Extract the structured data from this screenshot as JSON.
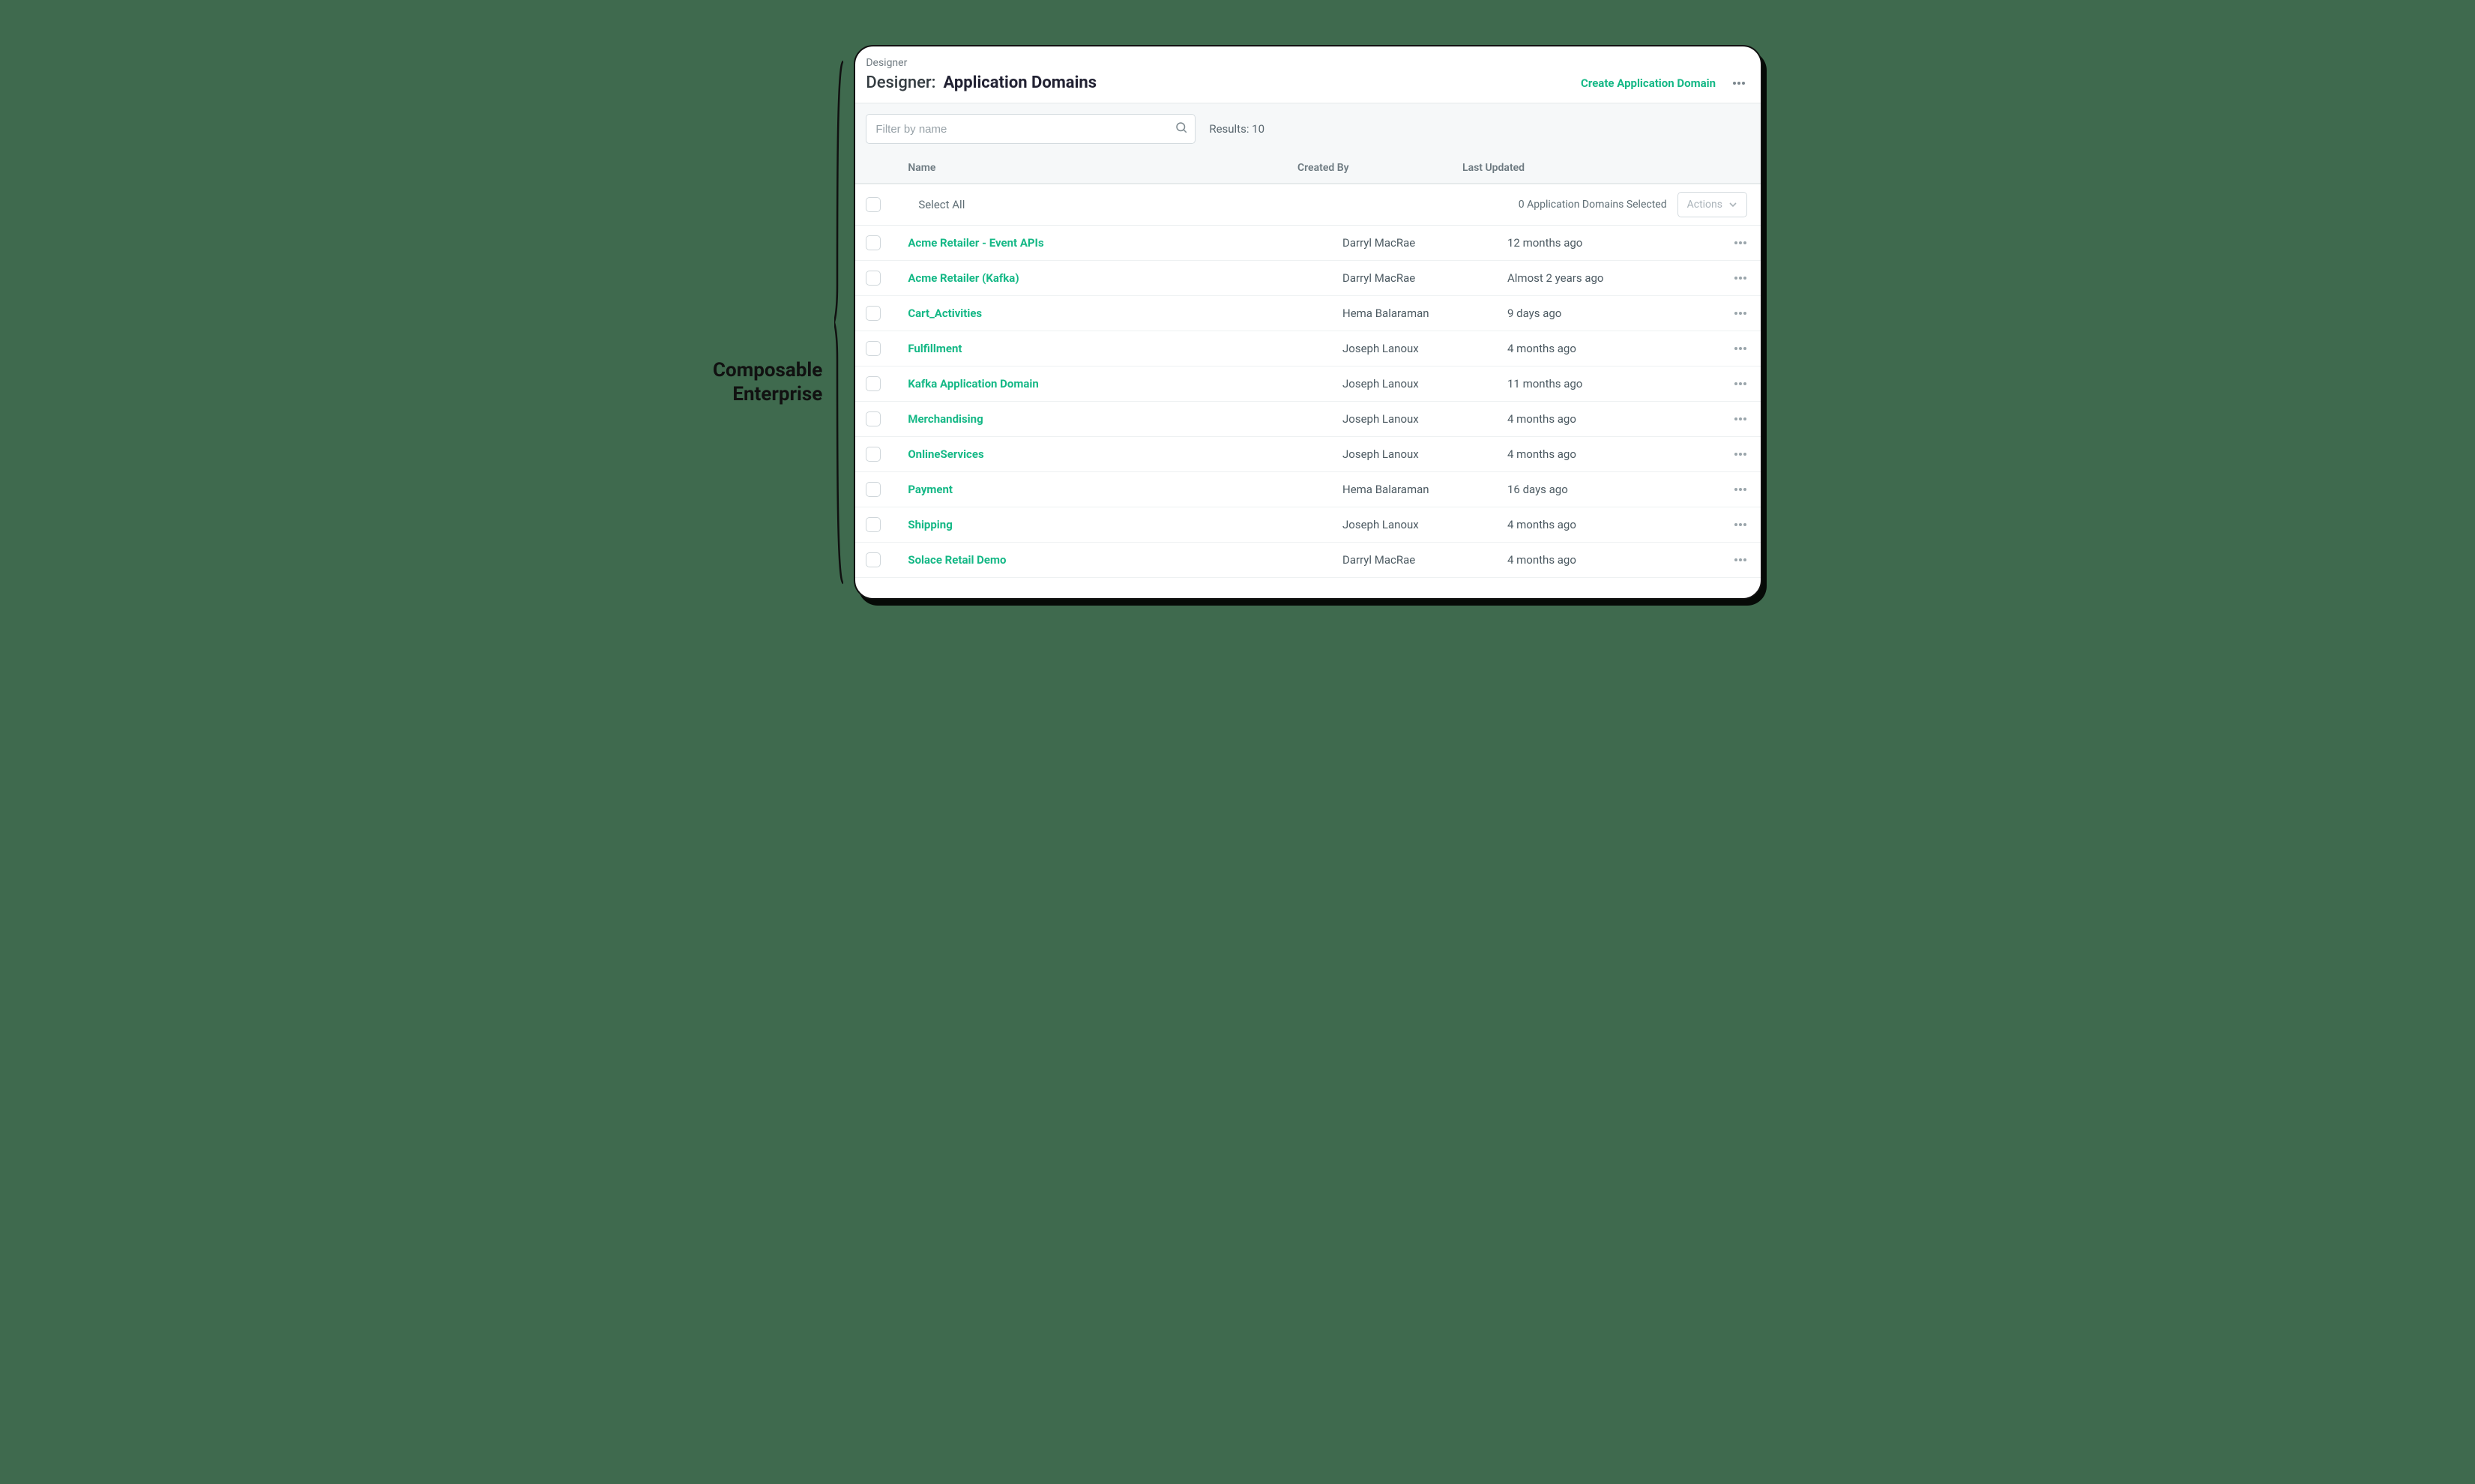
{
  "annotation": {
    "line1": "Composable",
    "line2": "Enterprise"
  },
  "breadcrumb": "Designer",
  "title": {
    "prefix": "Designer:",
    "main": "Application Domains"
  },
  "create_button": "Create Application Domain",
  "filter": {
    "placeholder": "Filter by name",
    "value": ""
  },
  "results_label": "Results: 10",
  "columns": {
    "name": "Name",
    "created_by": "Created By",
    "last_updated": "Last Updated"
  },
  "select_all": {
    "label": "Select All",
    "count_text": "0 Application Domains Selected",
    "actions_label": "Actions"
  },
  "rows": [
    {
      "name": "Acme Retailer - Event APIs",
      "created_by": "Darryl MacRae",
      "updated": "12 months ago"
    },
    {
      "name": "Acme Retailer (Kafka)",
      "created_by": "Darryl MacRae",
      "updated": "Almost 2 years ago"
    },
    {
      "name": "Cart_Activities",
      "created_by": "Hema Balaraman",
      "updated": "9 days ago"
    },
    {
      "name": "Fulfillment",
      "created_by": "Joseph Lanoux",
      "updated": "4 months ago"
    },
    {
      "name": "Kafka Application Domain",
      "created_by": "Joseph Lanoux",
      "updated": "11 months ago"
    },
    {
      "name": "Merchandising",
      "created_by": "Joseph Lanoux",
      "updated": "4 months ago"
    },
    {
      "name": "OnlineServices",
      "created_by": "Joseph Lanoux",
      "updated": "4 months ago"
    },
    {
      "name": "Payment",
      "created_by": "Hema Balaraman",
      "updated": "16 days ago"
    },
    {
      "name": "Shipping",
      "created_by": "Joseph Lanoux",
      "updated": "4 months ago"
    },
    {
      "name": "Solace Retail Demo",
      "created_by": "Darryl MacRae",
      "updated": "4 months ago"
    }
  ]
}
